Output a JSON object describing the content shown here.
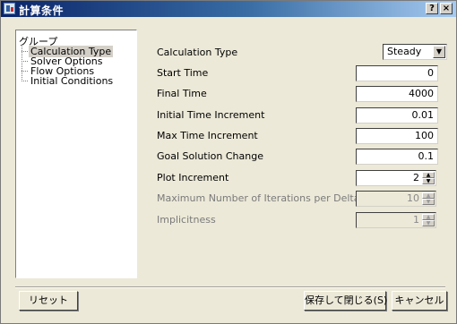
{
  "window": {
    "title": "計算条件",
    "help_label": "?",
    "close_label": "×"
  },
  "tree": {
    "root_label": "グループ",
    "items": [
      {
        "label": "Calculation Type",
        "selected": true
      },
      {
        "label": "Solver Options",
        "selected": false
      },
      {
        "label": "Flow Options",
        "selected": false
      },
      {
        "label": "Initial Conditions",
        "selected": false
      }
    ]
  },
  "form": {
    "calculation_type": {
      "label": "Calculation Type",
      "value": "Steady"
    },
    "start_time": {
      "label": "Start Time",
      "value": "0"
    },
    "final_time": {
      "label": "Final Time",
      "value": "4000"
    },
    "initial_time_increment": {
      "label": "Initial Time Increment",
      "value": "0.01"
    },
    "max_time_increment": {
      "label": "Max Time Increment",
      "value": "100"
    },
    "goal_solution_change": {
      "label": "Goal Solution Change",
      "value": "0.1"
    },
    "plot_increment": {
      "label": "Plot Increment",
      "value": "2"
    },
    "max_iterations": {
      "label": "Maximum Number of Iterations per Delta-Time",
      "value": "10",
      "disabled": true
    },
    "implicitness": {
      "label": "Implicitness",
      "value": "1",
      "disabled": true
    }
  },
  "footer": {
    "reset_label": "リセット",
    "save_close_label": "保存して閉じる(S)",
    "cancel_label": "キャンセル"
  },
  "icons": {
    "up_arrow": "▲",
    "down_arrow": "▼"
  }
}
